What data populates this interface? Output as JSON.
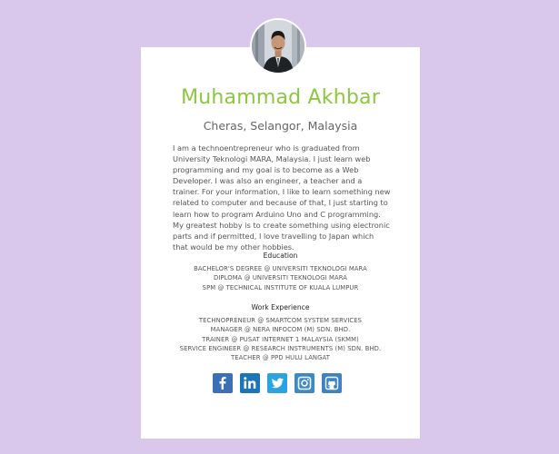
{
  "profile": {
    "name": "Muhammad Akhbar",
    "location": "Cheras, Selangor, Malaysia",
    "bio": "I am a technoentrepreneur who is graduated from University Teknologi MARA, Malaysia. I just learn web programming and my goal is to become as a Web Developer. I was also an engineer, a teacher and a trainer. For your information, I like to learn something new related to computer and because of that, I just starting to learn how to program Arduino Uno and C programming. My greatest hobby is to create something using electronic parts and if permitted, I love travelling to Japan which that would be my other hobbies."
  },
  "education": {
    "title": "Education",
    "items": [
      "BACHELOR'S DEGREE @ UNIVERSITI TEKNOLOGI MARA",
      "DIPLOMA @ UNIVERSITI TEKNOLOGI MARA",
      "SPM @ TECHNICAL INSTITUTE OF KUALA LUMPUR"
    ]
  },
  "work": {
    "title": "Work Experience",
    "items": [
      "TECHNOPRENEUR @ SMARTCOM SYSTEM SERVICES",
      "MANAGER @ NERA INFOCOM (M) SDN. BHD.",
      "TRAINER @ PUSAT INTERNET 1 MALAYSIA (SKMM)",
      "SERVICE ENGINEER @ RESEARCH INSTRUMENTS (M) SDN. BHD.",
      "TEACHER @ PPD HULU LANGAT"
    ]
  },
  "socials": [
    {
      "icon": "facebook-icon",
      "color": "#3b6fb6"
    },
    {
      "icon": "linkedin-icon",
      "color": "#1b75b8"
    },
    {
      "icon": "twitter-icon",
      "color": "#2aa3e3"
    },
    {
      "icon": "instagram-icon",
      "color": "#3d8ac9"
    },
    {
      "icon": "github-icon",
      "color": "#3c82c4"
    }
  ],
  "colors": {
    "background": "#d9c8ec",
    "card": "#ffffff",
    "name": "#8dc63f",
    "text": "#555555"
  }
}
